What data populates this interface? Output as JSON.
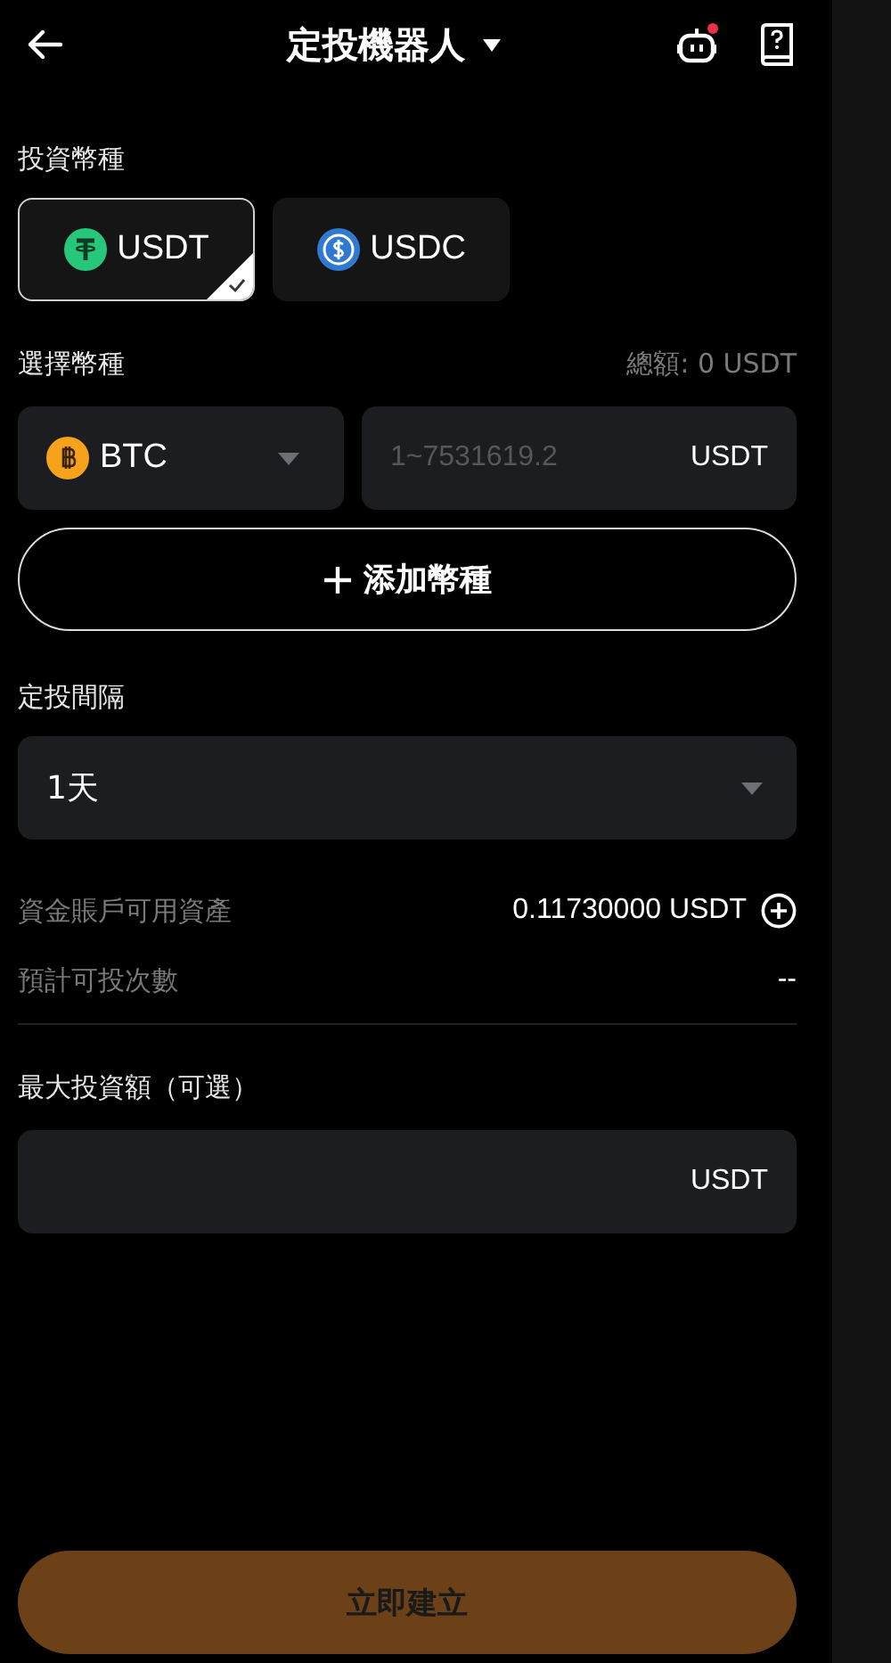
{
  "header": {
    "title": "定投機器人",
    "robot_notification": true
  },
  "invest_currency": {
    "label": "投資幣種",
    "options": [
      {
        "label": "USDT",
        "kind": "usdt",
        "selected": true
      },
      {
        "label": "USDC",
        "kind": "usdc",
        "selected": false
      }
    ]
  },
  "select_currency": {
    "label": "選擇幣種",
    "total": "總額: 0 USDT",
    "coin": {
      "label": "BTC",
      "kind": "btc"
    },
    "amount": {
      "placeholder": "1~7531619.2",
      "unit": "USDT"
    },
    "add_button": "添加幣種"
  },
  "interval": {
    "label": "定投間隔",
    "value": "1天"
  },
  "info_rows": [
    {
      "label": "資金賬戶可用資產",
      "value": "0.11730000 USDT",
      "has_add": true
    },
    {
      "label": "預計可投次數",
      "value": "--",
      "has_add": false
    }
  ],
  "max_invest": {
    "label": "最大投資額（可選）",
    "unit": "USDT"
  },
  "submit": "立即建立"
}
